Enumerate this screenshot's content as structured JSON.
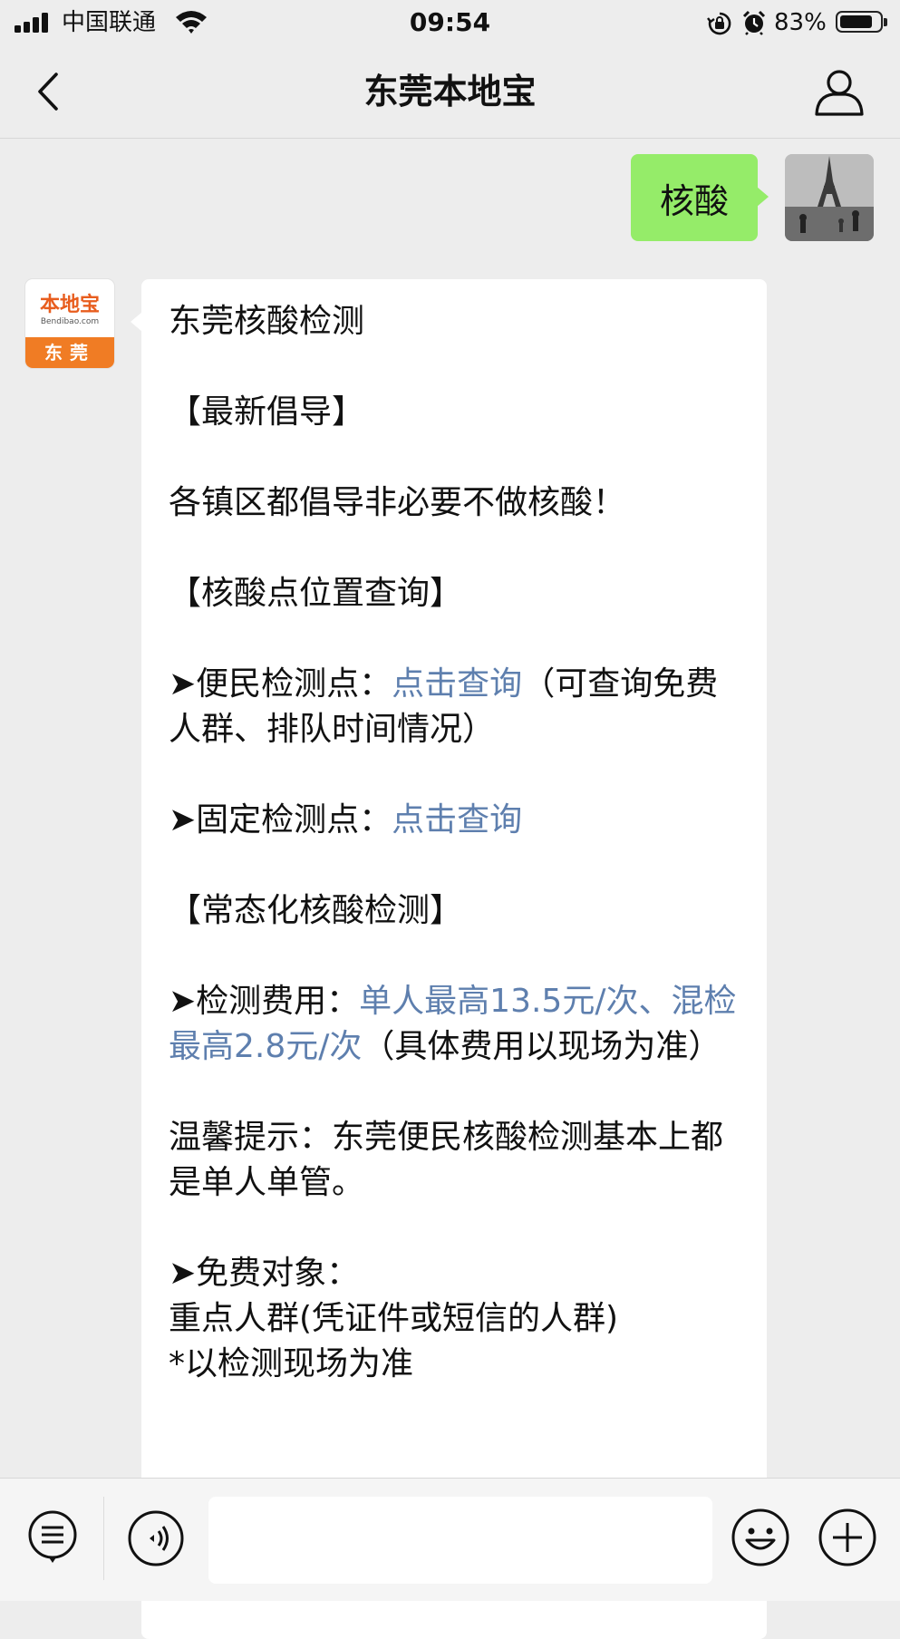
{
  "status_bar": {
    "carrier": "中国联通",
    "time": "09:54",
    "battery_percent": "83%",
    "battery_level": 0.83,
    "icons": [
      "signal-icon",
      "wifi-icon",
      "rotation-lock-icon",
      "alarm-icon",
      "battery-icon"
    ]
  },
  "nav": {
    "title": "东莞本地宝",
    "back_icon": "chevron-left-icon",
    "profile_icon": "person-icon"
  },
  "chat": {
    "outgoing": {
      "text": "核酸"
    },
    "bot_avatar": {
      "top": "本地宝",
      "url": "Bendibao.com",
      "bottom": "东莞"
    },
    "incoming": {
      "title": "东莞核酸检测",
      "sec1_heading": "【最新倡导】",
      "sec1_body": "各镇区都倡导非必要不做核酸！",
      "sec2_heading": "【核酸点位置查询】",
      "item1_label": "➤便民检测点：",
      "item1_link": "点击查询",
      "item1_note": "（可查询免费人群、排队时间情况）",
      "item2_label": "➤固定检测点：",
      "item2_link": "点击查询",
      "sec3_heading": "【常态化核酸检测】",
      "fee_label": "➤检测费用：",
      "fee_link": "单人最高13.5元/次、混检最高2.8元/次",
      "fee_note": "（具体费用以现场为准）",
      "tip": "温馨提示：东莞便民核酸检测基本上都是单人单管。",
      "free_label": "➤免费对象：",
      "free_body": "重点人群(凭证件或短信的人群)",
      "free_note": "*以检测现场为准"
    }
  },
  "input_bar": {
    "icons": [
      "menu-list-icon",
      "voice-icon",
      "emoji-icon",
      "plus-icon"
    ],
    "value": ""
  }
}
